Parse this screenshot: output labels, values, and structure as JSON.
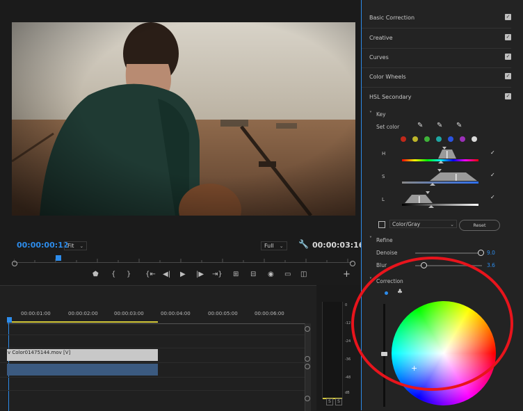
{
  "monitor": {
    "current_timecode": "00:00:00:12",
    "zoom": "Fit",
    "resolution": "Full",
    "duration_timecode": "00:00:03:16"
  },
  "timeline": {
    "time_ticks": [
      "00:00:01:00",
      "00:00:02:00",
      "00:00:03:00",
      "00:00:04:00",
      "00:00:05:00",
      "00:00:06:00"
    ],
    "video_clip_label": "v Color01475144.mov [V]"
  },
  "meter": {
    "ticks": [
      "0",
      "-12",
      "-24",
      "-36",
      "-48",
      "dB"
    ],
    "solo_labels": [
      "S",
      "S"
    ]
  },
  "panel": {
    "sections": [
      "Basic Correction",
      "Creative",
      "Curves",
      "Color Wheels",
      "HSL Secondary"
    ],
    "key_label": "Key",
    "set_color_label": "Set color",
    "swatch_colors": [
      "#c0281a",
      "#bdb52a",
      "#3fb339",
      "#1ea7a3",
      "#2a53e0",
      "#9b30b8",
      "#d9d9d9"
    ],
    "h_label": "H",
    "s_label": "S",
    "l_label": "L",
    "color_gray_option": "Color/Gray",
    "reset_label": "Reset",
    "refine_label": "Refine",
    "denoise_label": "Denoise",
    "denoise_value": "9.0",
    "blur_label": "Blur",
    "blur_value": "3.6",
    "correction_label": "Correction"
  },
  "colors": {
    "accent": "#2d8ceb",
    "annotation": "#e8141c"
  }
}
